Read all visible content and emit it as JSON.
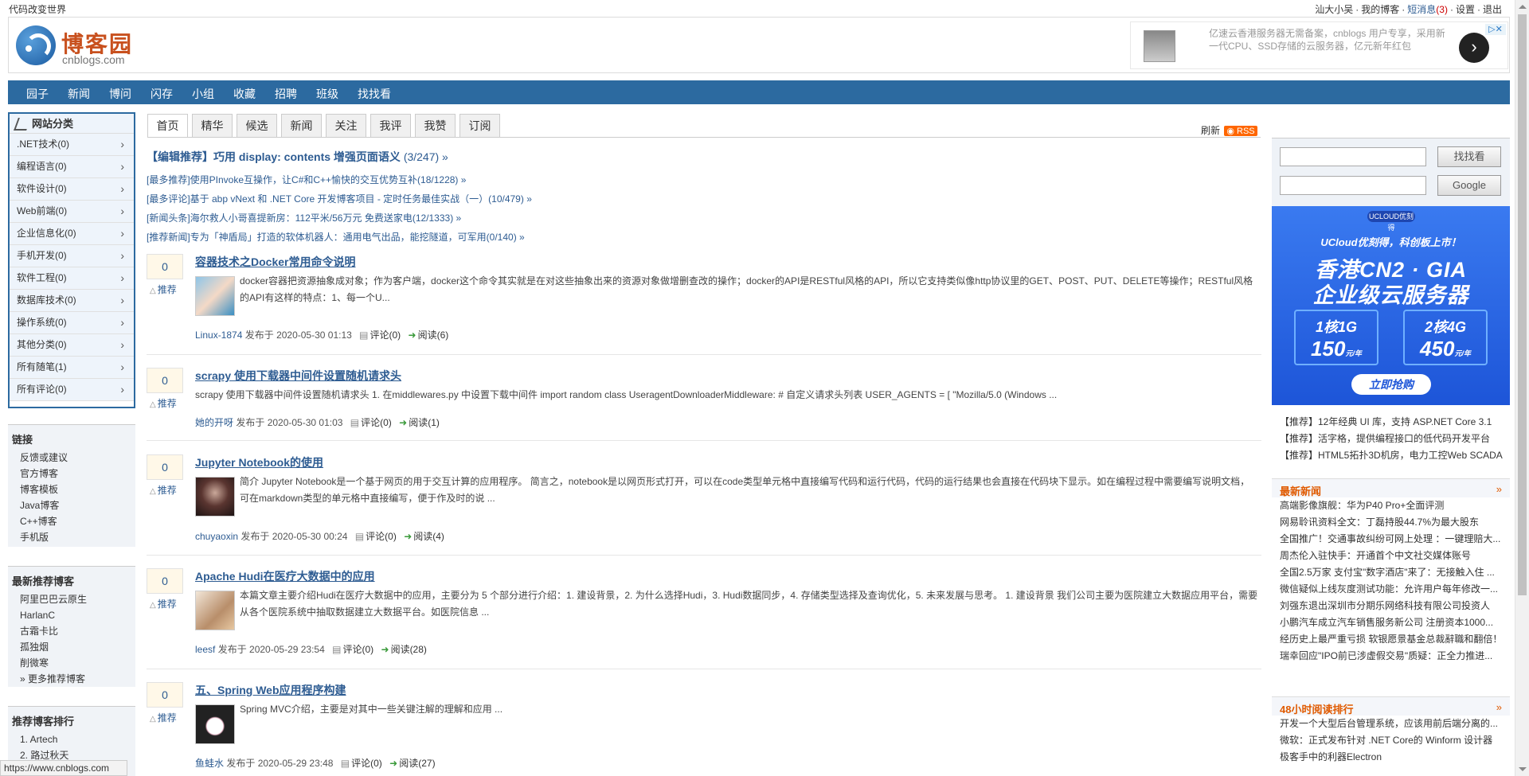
{
  "top": {
    "slogan": "代码改变世界",
    "user": "汕大小吴",
    "my_blog": "我的博客",
    "messages_label": "短消息",
    "messages_count": "(3)",
    "settings": "设置",
    "logout": "退出"
  },
  "logo": {
    "name": "博客园",
    "domain": "cnblogs.com"
  },
  "ad_top": {
    "text": "亿速云香港服务器无需备案，cnblogs 用户专享，采用新一代CPU、SSD存储的云服务器，亿元新年红包"
  },
  "nav": [
    "园子",
    "新闻",
    "博问",
    "闪存",
    "小组",
    "收藏",
    "招聘",
    "班级",
    "找找看"
  ],
  "categories": {
    "title": "网站分类",
    "items": [
      ".NET技术(0)",
      "编程语言(0)",
      "软件设计(0)",
      "Web前端(0)",
      "企业信息化(0)",
      "手机开发(0)",
      "软件工程(0)",
      "数据库技术(0)",
      "操作系统(0)",
      "其他分类(0)",
      "所有随笔(1)",
      "所有评论(0)"
    ]
  },
  "links": {
    "title": "链接",
    "items": [
      "反馈或建议",
      "官方博客",
      "博客模板",
      "Java博客",
      "C++博客",
      "手机版"
    ]
  },
  "recommended_bloggers": {
    "title": "最新推荐博客",
    "items": [
      "阿里巴巴云原生",
      "HarlanC",
      "古霜卡比",
      "孤独烟",
      "削微寒",
      "» 更多推荐博客"
    ]
  },
  "blogger_rank": {
    "title": "推荐博客排行",
    "items": [
      "1. Artech",
      "2. 路过秋天"
    ]
  },
  "tabs": [
    "首页",
    "精华",
    "候选",
    "新闻",
    "关注",
    "我评",
    "我赞",
    "订阅"
  ],
  "refresh": "刷新",
  "rss": "RSS",
  "notices": {
    "editor": "【编辑推荐】巧用 display: contents 增强页面语义",
    "editor_count": "(3/247) »",
    "items": [
      "[最多推荐]使用PInvoke互操作，让C#和C++愉快的交互优势互补(18/1228) »",
      "[最多评论]基于 abp vNext 和 .NET Core 开发博客项目 - 定时任务最佳实战（一）(10/479) »",
      "[新闻头条]海尔救人小哥喜提新房：112平米/56万元 免费送家电(12/1333) »",
      "[推荐新闻]专为「神盾局」打造的软体机器人：通用电气出品，能挖隧道，可军用(0/140) »"
    ]
  },
  "posts": [
    {
      "votes": "0",
      "recommend": "推荐",
      "title": "容器技术之Docker常用命令说明",
      "summary": "docker容器把资源抽象成对象；作为客户端，docker这个命令其实就是在对这些抽象出来的资源对象做增删查改的操作；docker的API是RESTful风格的API，所以它支持类似像http协议里的GET、POST、PUT、DELETE等操作；RESTful风格的API有这样的特点：1、每一个U...",
      "author": "Linux-1874",
      "published": "发布于 2020-05-30 01:13",
      "comments": "评论(0)",
      "reads": "阅读(6)"
    },
    {
      "votes": "0",
      "recommend": "推荐",
      "title": "scrapy 使用下载器中间件设置随机请求头",
      "summary": "scrapy 使用下载器中间件设置随机请求头 1. 在middlewares.py 中设置下载中间件 import random class UseragentDownloaderMiddleware: # 自定义请求头列表 USER_AGENTS = [ \"Mozilla/5.0 (Windows ...",
      "author": "她的开呀",
      "published": "发布于 2020-05-30 01:03",
      "comments": "评论(0)",
      "reads": "阅读(1)"
    },
    {
      "votes": "0",
      "recommend": "推荐",
      "title": "Jupyter Notebook的使用",
      "summary": "简介 Jupyter Notebook是一个基于网页的用于交互计算的应用程序。 简言之，notebook是以网页形式打开，可以在code类型单元格中直接编写代码和运行代码，代码的运行结果也会直接在代码块下显示。如在编程过程中需要编写说明文档，可在markdown类型的单元格中直接编写，便于作及时的说 ...",
      "author": "chuyaoxin",
      "published": "发布于 2020-05-30 00:24",
      "comments": "评论(0)",
      "reads": "阅读(4)"
    },
    {
      "votes": "0",
      "recommend": "推荐",
      "title": "Apache Hudi在医疗大数据中的应用",
      "summary": "本篇文章主要介绍Hudi在医疗大数据中的应用，主要分为 5 个部分进行介绍：1. 建设背景，2. 为什么选择Hudi，3. Hudi数据同步，4. 存储类型选择及查询优化，5. 未来发展与思考。 1. 建设背景 我们公司主要为医院建立大数据应用平台，需要从各个医院系统中抽取数据建立大数据平台。如医院信息 ...",
      "author": "leesf",
      "published": "发布于 2020-05-29 23:54",
      "comments": "评论(0)",
      "reads": "阅读(28)"
    },
    {
      "votes": "0",
      "recommend": "推荐",
      "title": "五、Spring Web应用程序构建",
      "summary": "Spring MVC介绍，主要是对其中一些关键注解的理解和应用 ...",
      "author": "鱼蛙水",
      "published": "发布于 2020-05-29 23:48",
      "comments": "评论(0)",
      "reads": "阅读(27)"
    }
  ],
  "search": {
    "zzk": "找找看",
    "google": "Google"
  },
  "ucloud": {
    "pill": "UCLOUD优刻得",
    "line1": "UCloud优刻得，科创板上市！",
    "line2": "香港CN2 · GIA",
    "line3": "企业级云服务器",
    "box1_spec": "1核1G",
    "box1_price": "150",
    "box1_unit": "元/年",
    "box2_spec": "2核4G",
    "box2_price": "450",
    "box2_unit": "元/年",
    "cta": "立即抢购"
  },
  "promos": [
    "【推荐】12年经典 UI 库，支持 ASP.NET Core 3.1",
    "【推荐】活字格，提供编程接口的低代码开发平台",
    "【推荐】HTML5拓扑3D机房，电力工控Web SCADA"
  ],
  "latest_news": {
    "title": "最新新闻",
    "more": "»",
    "items": [
      "高端影像旗舰：华为P40 Pro+全面评测",
      "网易聆讯资料全文：丁磊持股44.7%为最大股东",
      "全国推广！交通事故纠纷可网上处理 ：一键理赔大...",
      "周杰伦入驻快手：开通首个中文社交媒体账号",
      "全国2.5万家 支付宝\"数字酒店\"来了：无接触入住 ...",
      "微信疑似上线灰度测试功能：允许用户每年修改一...",
      "刘强东退出深圳市分期乐网络科技有限公司投资人",
      "小鹏汽车成立汽车销售服务新公司 注册资本1000...",
      "经历史上最严重亏损 软银愿景基金总裁辭職和翻倍！",
      "瑞幸回应\"IPO前已涉虚假交易\"质疑：正全力推进..."
    ]
  },
  "hot48": {
    "title": "48小时阅读排行",
    "more": "»",
    "items": [
      "开发一个大型后台管理系统，应该用前后端分离的...",
      "微软：正式发布针对 .NET Core的 Winform 设计器",
      "极客手中的利器Electron"
    ]
  },
  "status": "https://www.cnblogs.com"
}
